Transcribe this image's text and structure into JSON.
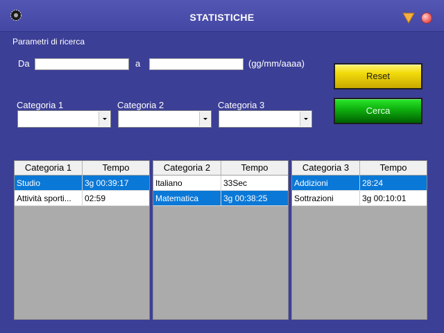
{
  "window": {
    "title": "STATISTICHE"
  },
  "search": {
    "section_label": "Parametri di ricerca",
    "from_label": "Da",
    "to_label": "a",
    "format_hint": "(gg/mm/aaaa)",
    "from_value": "",
    "to_value": ""
  },
  "filters": {
    "category1_label": "Categoria 1",
    "category2_label": "Categoria 2",
    "category3_label": "Categoria 3",
    "category1_value": "",
    "category2_value": "",
    "category3_value": ""
  },
  "buttons": {
    "reset_label": "Reset",
    "search_label": "Cerca"
  },
  "tables": [
    {
      "headers": [
        "Categoria 1",
        "Tempo"
      ],
      "rows": [
        {
          "name": "Studio",
          "time": "3g 00:39:17",
          "selected": true
        },
        {
          "name": "Attività sporti...",
          "time": "02:59",
          "selected": false
        }
      ]
    },
    {
      "headers": [
        "Categoria 2",
        "Tempo"
      ],
      "rows": [
        {
          "name": "Italiano",
          "time": "33Sec",
          "selected": false
        },
        {
          "name": "Matematica",
          "time": "3g 00:38:25",
          "selected": true
        }
      ]
    },
    {
      "headers": [
        "Categoria 3",
        "Tempo"
      ],
      "rows": [
        {
          "name": "Addizioni",
          "time": "28:24",
          "selected": true
        },
        {
          "name": "Sottrazioni",
          "time": "3g 00:10:01",
          "selected": false
        }
      ]
    }
  ],
  "colors": {
    "background": "#3c3f96",
    "selection": "#0a78d7",
    "reset_button": "#f2dc0c",
    "search_button": "#10b410"
  },
  "icons": {
    "app": "gear-icon",
    "minimize": "triangle-down-icon",
    "close": "close-circle-icon"
  }
}
